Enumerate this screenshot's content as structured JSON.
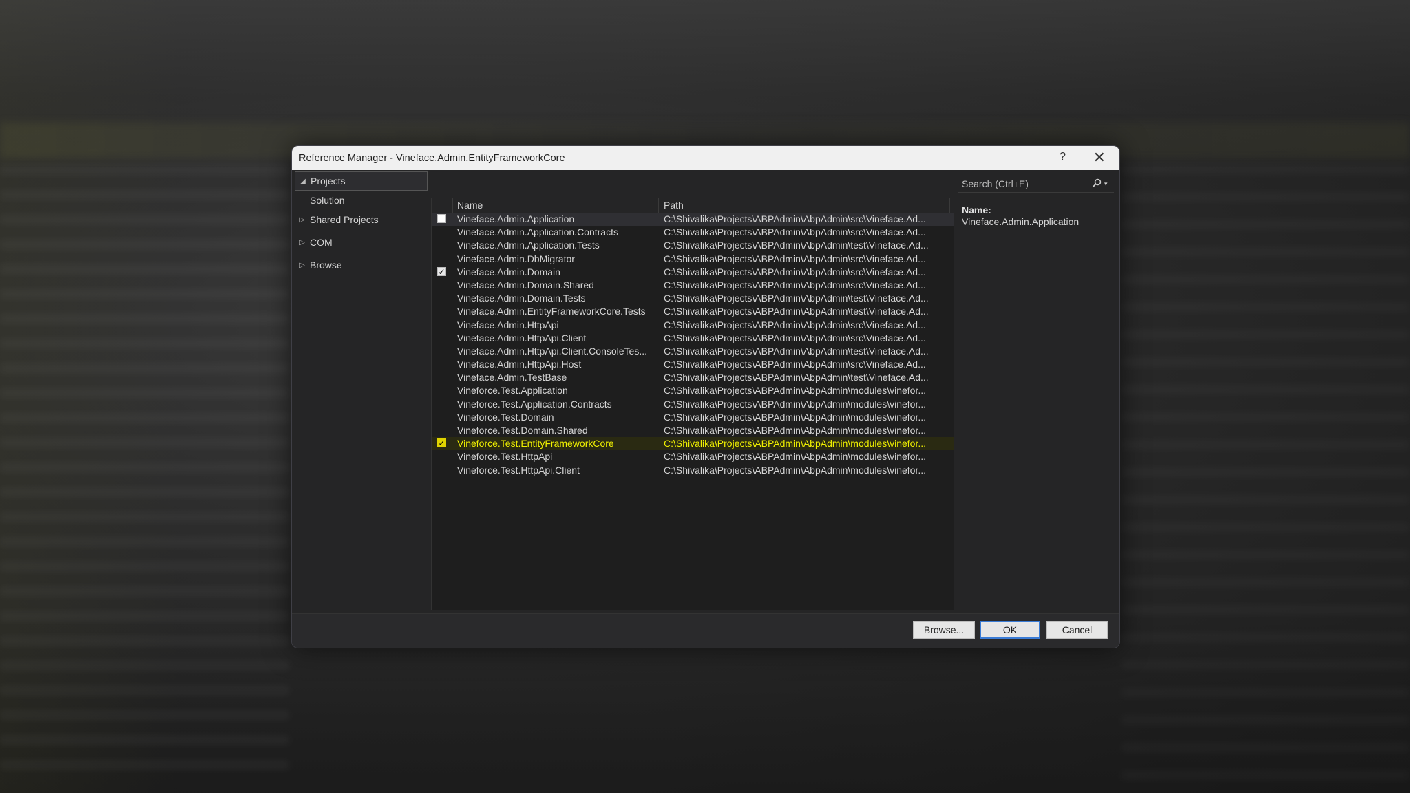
{
  "dialog": {
    "title": "Reference Manager - Vineface.Admin.EntityFrameworkCore",
    "help_glyph": "?",
    "close_glyph": "✕"
  },
  "tree": [
    {
      "label": "Projects",
      "expanded": true,
      "arrow": "◢"
    },
    {
      "label": "Solution",
      "arrow": ""
    },
    {
      "label": "Shared Projects",
      "arrow": "▷"
    },
    {
      "label": "COM",
      "arrow": "▷"
    },
    {
      "label": "Browse",
      "arrow": "▷"
    }
  ],
  "list": {
    "columns": {
      "name": "Name",
      "path": "Path"
    },
    "rows": [
      {
        "name": "Vineface.Admin.Application",
        "path": "C:\\Shivalika\\Projects\\ABPAdmin\\AbpAdmin\\src\\Vineface.Ad...",
        "checked": "off",
        "state": "active"
      },
      {
        "name": "Vineface.Admin.Application.Contracts",
        "path": "C:\\Shivalika\\Projects\\ABPAdmin\\AbpAdmin\\src\\Vineface.Ad...",
        "checked": "none",
        "state": ""
      },
      {
        "name": "Vineface.Admin.Application.Tests",
        "path": "C:\\Shivalika\\Projects\\ABPAdmin\\AbpAdmin\\test\\Vineface.Ad...",
        "checked": "none",
        "state": ""
      },
      {
        "name": "Vineface.Admin.DbMigrator",
        "path": "C:\\Shivalika\\Projects\\ABPAdmin\\AbpAdmin\\src\\Vineface.Ad...",
        "checked": "none",
        "state": ""
      },
      {
        "name": "Vineface.Admin.Domain",
        "path": "C:\\Shivalika\\Projects\\ABPAdmin\\AbpAdmin\\src\\Vineface.Ad...",
        "checked": "on",
        "state": ""
      },
      {
        "name": "Vineface.Admin.Domain.Shared",
        "path": "C:\\Shivalika\\Projects\\ABPAdmin\\AbpAdmin\\src\\Vineface.Ad...",
        "checked": "none",
        "state": ""
      },
      {
        "name": "Vineface.Admin.Domain.Tests",
        "path": "C:\\Shivalika\\Projects\\ABPAdmin\\AbpAdmin\\test\\Vineface.Ad...",
        "checked": "none",
        "state": ""
      },
      {
        "name": "Vineface.Admin.EntityFrameworkCore.Tests",
        "path": "C:\\Shivalika\\Projects\\ABPAdmin\\AbpAdmin\\test\\Vineface.Ad...",
        "checked": "none",
        "state": ""
      },
      {
        "name": "Vineface.Admin.HttpApi",
        "path": "C:\\Shivalika\\Projects\\ABPAdmin\\AbpAdmin\\src\\Vineface.Ad...",
        "checked": "none",
        "state": ""
      },
      {
        "name": "Vineface.Admin.HttpApi.Client",
        "path": "C:\\Shivalika\\Projects\\ABPAdmin\\AbpAdmin\\src\\Vineface.Ad...",
        "checked": "none",
        "state": ""
      },
      {
        "name": "Vineface.Admin.HttpApi.Client.ConsoleTes...",
        "path": "C:\\Shivalika\\Projects\\ABPAdmin\\AbpAdmin\\test\\Vineface.Ad...",
        "checked": "none",
        "state": ""
      },
      {
        "name": "Vineface.Admin.HttpApi.Host",
        "path": "C:\\Shivalika\\Projects\\ABPAdmin\\AbpAdmin\\src\\Vineface.Ad...",
        "checked": "none",
        "state": ""
      },
      {
        "name": "Vineface.Admin.TestBase",
        "path": "C:\\Shivalika\\Projects\\ABPAdmin\\AbpAdmin\\test\\Vineface.Ad...",
        "checked": "none",
        "state": ""
      },
      {
        "name": "Vineforce.Test.Application",
        "path": "C:\\Shivalika\\Projects\\ABPAdmin\\AbpAdmin\\modules\\vinefor...",
        "checked": "none",
        "state": ""
      },
      {
        "name": "Vineforce.Test.Application.Contracts",
        "path": "C:\\Shivalika\\Projects\\ABPAdmin\\AbpAdmin\\modules\\vinefor...",
        "checked": "none",
        "state": ""
      },
      {
        "name": "Vineforce.Test.Domain",
        "path": "C:\\Shivalika\\Projects\\ABPAdmin\\AbpAdmin\\modules\\vinefor...",
        "checked": "none",
        "state": ""
      },
      {
        "name": "Vineforce.Test.Domain.Shared",
        "path": "C:\\Shivalika\\Projects\\ABPAdmin\\AbpAdmin\\modules\\vinefor...",
        "checked": "none",
        "state": ""
      },
      {
        "name": "Vineforce.Test.EntityFrameworkCore",
        "path": "C:\\Shivalika\\Projects\\ABPAdmin\\AbpAdmin\\modules\\vinefor...",
        "checked": "on",
        "state": "highlight"
      },
      {
        "name": "Vineforce.Test.HttpApi",
        "path": "C:\\Shivalika\\Projects\\ABPAdmin\\AbpAdmin\\modules\\vinefor...",
        "checked": "none",
        "state": ""
      },
      {
        "name": "Vineforce.Test.HttpApi.Client",
        "path": "C:\\Shivalika\\Projects\\ABPAdmin\\AbpAdmin\\modules\\vinefor...",
        "checked": "none",
        "state": ""
      }
    ]
  },
  "search": {
    "placeholder": "Search (Ctrl+E)",
    "value": "",
    "icon": "search-icon"
  },
  "details": {
    "name_label": "Name:",
    "name_value": "Vineface.Admin.Application"
  },
  "footer": {
    "browse_label": "Browse...",
    "ok_label": "OK",
    "cancel_label": "Cancel"
  },
  "colors": {
    "highlight_text": "#f0f000",
    "accent": "#3a7bd5"
  }
}
